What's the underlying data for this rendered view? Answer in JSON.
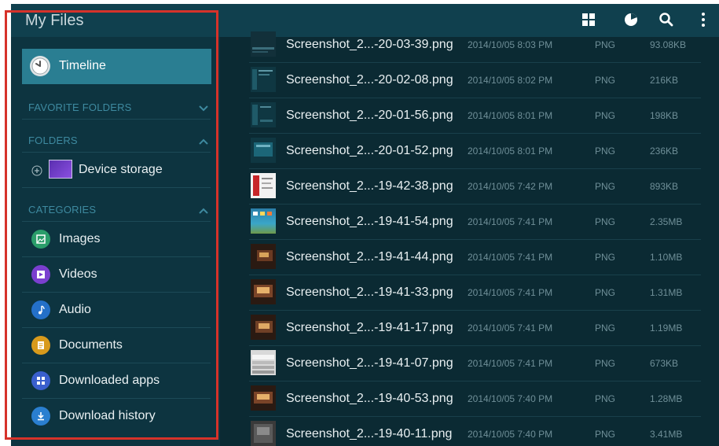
{
  "app": {
    "title": "My Files"
  },
  "toolbar": {
    "icons": [
      "view-grid-icon",
      "storage-usage-icon",
      "search-icon",
      "more-options-icon"
    ]
  },
  "sidebar": {
    "timeline": "Timeline",
    "favorite_header": "FAVORITE FOLDERS",
    "folders_header": "FOLDERS",
    "device_storage": "Device storage",
    "categories_header": "CATEGORIES",
    "categories": [
      {
        "label": "Images",
        "icon": "image-icon",
        "color": "#2a9d6a"
      },
      {
        "label": "Videos",
        "icon": "video-icon",
        "color": "#7a3fcf"
      },
      {
        "label": "Audio",
        "icon": "music-note-icon",
        "color": "#2470c8"
      },
      {
        "label": "Documents",
        "icon": "document-icon",
        "color": "#d89a1c"
      },
      {
        "label": "Downloaded apps",
        "icon": "apps-icon",
        "color": "#3a5fcd"
      },
      {
        "label": "Download history",
        "icon": "download-icon",
        "color": "#2a7fd0"
      }
    ]
  },
  "files": [
    {
      "name": "Screenshot_2...-20-03-39.png",
      "date": "2014/10/05 8:03 PM",
      "type": "PNG",
      "size": "93.08KB"
    },
    {
      "name": "Screenshot_2...-20-02-08.png",
      "date": "2014/10/05 8:02 PM",
      "type": "PNG",
      "size": "216KB"
    },
    {
      "name": "Screenshot_2...-20-01-56.png",
      "date": "2014/10/05 8:01 PM",
      "type": "PNG",
      "size": "198KB"
    },
    {
      "name": "Screenshot_2...-20-01-52.png",
      "date": "2014/10/05 8:01 PM",
      "type": "PNG",
      "size": "236KB"
    },
    {
      "name": "Screenshot_2...-19-42-38.png",
      "date": "2014/10/05 7:42 PM",
      "type": "PNG",
      "size": "893KB"
    },
    {
      "name": "Screenshot_2...-19-41-54.png",
      "date": "2014/10/05 7:41 PM",
      "type": "PNG",
      "size": "2.35MB"
    },
    {
      "name": "Screenshot_2...-19-41-44.png",
      "date": "2014/10/05 7:41 PM",
      "type": "PNG",
      "size": "1.10MB"
    },
    {
      "name": "Screenshot_2...-19-41-33.png",
      "date": "2014/10/05 7:41 PM",
      "type": "PNG",
      "size": "1.31MB"
    },
    {
      "name": "Screenshot_2...-19-41-17.png",
      "date": "2014/10/05 7:41 PM",
      "type": "PNG",
      "size": "1.19MB"
    },
    {
      "name": "Screenshot_2...-19-41-07.png",
      "date": "2014/10/05 7:41 PM",
      "type": "PNG",
      "size": "673KB"
    },
    {
      "name": "Screenshot_2...-19-40-53.png",
      "date": "2014/10/05 7:40 PM",
      "type": "PNG",
      "size": "1.28MB"
    },
    {
      "name": "Screenshot_2...-19-40-11.png",
      "date": "2014/10/05 7:40 PM",
      "type": "PNG",
      "size": "3.41MB"
    }
  ],
  "colors": {
    "accent": "#2a7e92",
    "highlight": "#d6322a",
    "background": "#0b2a33"
  }
}
